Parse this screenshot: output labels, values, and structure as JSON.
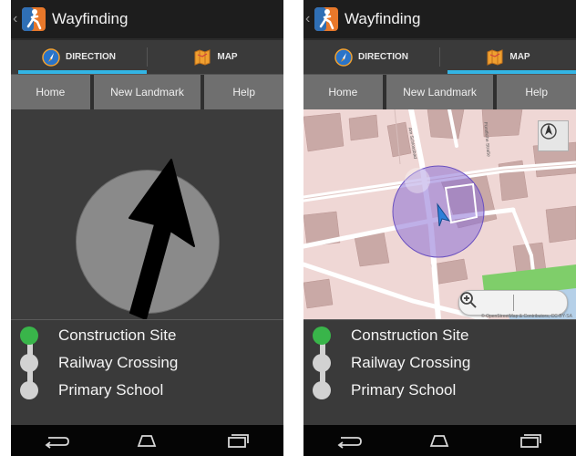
{
  "screens": [
    {
      "app_title": "Wayfinding",
      "tabs": [
        {
          "label": "DIRECTION",
          "icon": "compass-icon",
          "active": true
        },
        {
          "label": "MAP",
          "icon": "map-icon",
          "active": false
        }
      ],
      "actions": [
        "Home",
        "New Landmark",
        "Help"
      ],
      "landmarks": [
        {
          "name": "Construction Site",
          "status": "current"
        },
        {
          "name": "Railway Crossing",
          "status": "upcoming"
        },
        {
          "name": "Primary School",
          "status": "upcoming"
        }
      ]
    },
    {
      "app_title": "Wayfinding",
      "tabs": [
        {
          "label": "DIRECTION",
          "icon": "compass-icon",
          "active": false
        },
        {
          "label": "MAP",
          "icon": "map-icon",
          "active": true
        }
      ],
      "actions": [
        "Home",
        "New Landmark",
        "Help"
      ],
      "map": {
        "attribution": "© OpenStreetMap & Contributors, CC-BY-SA",
        "street_labels": [
          "Am Schlossbad",
          "Fürstliche Straße"
        ]
      },
      "landmarks": [
        {
          "name": "Construction Site",
          "status": "current"
        },
        {
          "name": "Railway Crossing",
          "status": "upcoming"
        },
        {
          "name": "Primary School",
          "status": "upcoming"
        }
      ]
    }
  ],
  "colors": {
    "accent": "#33b5e5",
    "current_landmark": "#39b54a",
    "upcoming_landmark": "#d2d2d2"
  }
}
